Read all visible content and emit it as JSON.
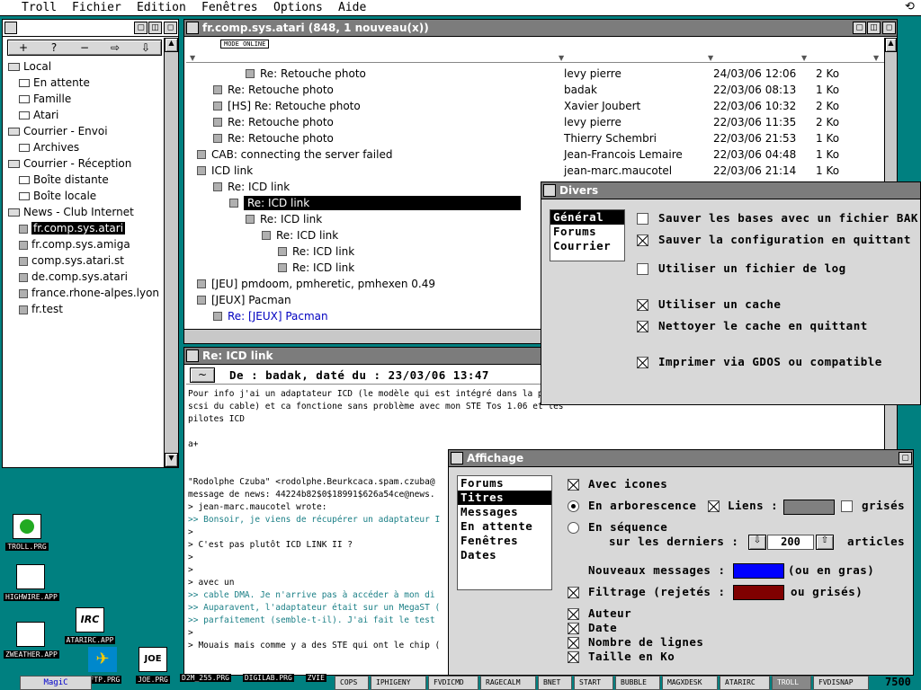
{
  "menu": {
    "items": [
      "Troll",
      "Fichier",
      "Edition",
      "Fenêtres",
      "Options",
      "Aide"
    ]
  },
  "left_toolbar": {
    "buttons": [
      "+",
      "?",
      "−",
      "⇨",
      "⇩"
    ]
  },
  "tree": {
    "items": [
      {
        "label": "Local",
        "level": 0,
        "icon": "folder-icon"
      },
      {
        "label": "En attente",
        "level": 1,
        "icon": "envelope-icon"
      },
      {
        "label": "Famille",
        "level": 1,
        "icon": "envelope-icon"
      },
      {
        "label": "Atari",
        "level": 1,
        "icon": "envelope-icon"
      },
      {
        "label": "Courrier - Envoi",
        "level": 0,
        "icon": "folder-icon"
      },
      {
        "label": "Archives",
        "level": 1,
        "icon": "envelope-icon"
      },
      {
        "label": "Courrier - Réception",
        "level": 0,
        "icon": "folder-icon"
      },
      {
        "label": "Boîte distante",
        "level": 1,
        "icon": "envelope-icon"
      },
      {
        "label": "Boîte locale",
        "level": 1,
        "icon": "envelope-icon"
      },
      {
        "label": "News - Club Internet",
        "level": 0,
        "icon": "folder-icon"
      },
      {
        "label": "fr.comp.sys.atari",
        "level": 1,
        "icon": "newsgroup-icon",
        "selected": true
      },
      {
        "label": "fr.comp.sys.amiga",
        "level": 1,
        "icon": "newsgroup-icon"
      },
      {
        "label": "comp.sys.atari.st",
        "level": 1,
        "icon": "newsgroup-icon"
      },
      {
        "label": "de.comp.sys.atari",
        "level": 1,
        "icon": "newsgroup-icon"
      },
      {
        "label": "france.rhone-alpes.lyon",
        "level": 1,
        "icon": "newsgroup-icon"
      },
      {
        "label": "fr.test",
        "level": 1,
        "icon": "newsgroup-icon"
      }
    ]
  },
  "thread_window": {
    "title": "fr.comp.sys.atari (848, 1 nouveau(x))",
    "mode_label": "MODE ONLINE",
    "rows": [
      {
        "subject": "Re: Retouche photo",
        "indent": 3,
        "from": "levy pierre",
        "date": "24/03/06 12:06",
        "size": "2 Ko"
      },
      {
        "subject": "Re: Retouche photo",
        "indent": 1,
        "from": "badak",
        "date": "22/03/06 08:13",
        "size": "1 Ko"
      },
      {
        "subject": "[HS] Re: Retouche photo",
        "indent": 1,
        "from": "Xavier Joubert",
        "date": "22/03/06 10:32",
        "size": "2 Ko"
      },
      {
        "subject": "Re: Retouche photo",
        "indent": 1,
        "from": "levy pierre",
        "date": "22/03/06 11:35",
        "size": "2 Ko"
      },
      {
        "subject": "Re: Retouche photo",
        "indent": 1,
        "from": "Thierry Schembri",
        "date": "22/03/06 21:53",
        "size": "1 Ko"
      },
      {
        "subject": "CAB: connecting the server failed",
        "indent": 0,
        "from": "Jean-Francois Lemaire",
        "date": "22/03/06 04:48",
        "size": "1 Ko"
      },
      {
        "subject": "ICD link",
        "indent": 0,
        "from": "jean-marc.maucotel",
        "date": "22/03/06 21:14",
        "size": "1 Ko"
      },
      {
        "subject": "Re: ICD link",
        "indent": 1,
        "from": "",
        "date": "",
        "size": ""
      },
      {
        "subject": "Re: ICD link",
        "indent": 2,
        "from": "",
        "date": "",
        "size": "",
        "selected": true
      },
      {
        "subject": "Re: ICD link",
        "indent": 3,
        "from": "",
        "date": "",
        "size": ""
      },
      {
        "subject": "Re: ICD link",
        "indent": 4,
        "from": "",
        "date": "",
        "size": ""
      },
      {
        "subject": "Re: ICD link",
        "indent": 5,
        "from": "",
        "date": "",
        "size": ""
      },
      {
        "subject": "Re: ICD link",
        "indent": 5,
        "from": "",
        "date": "",
        "size": ""
      },
      {
        "subject": "[JEU] pmdoom, pmheretic, pmhexen 0.49",
        "indent": 0,
        "from": "",
        "date": "",
        "size": ""
      },
      {
        "subject": "[JEUX] Pacman",
        "indent": 0,
        "from": "",
        "date": "",
        "size": ""
      },
      {
        "subject": "Re: [JEUX] Pacman",
        "indent": 1,
        "from": "",
        "date": "",
        "size": "",
        "new": true
      }
    ]
  },
  "message_window": {
    "title": "Re: ICD link",
    "header": "De : badak, daté du : 23/03/06 13:47",
    "lines": [
      {
        "text": "Pour info j'ai un adaptateur ICD (le modèle qui est intégré dans la prise",
        "quote": false
      },
      {
        "text": "scsi du cable) et ca fonctione sans problème avec mon STE Tos 1.06 et les",
        "quote": false
      },
      {
        "text": "pilotes ICD",
        "quote": false
      },
      {
        "text": "",
        "quote": false
      },
      {
        "text": "a+",
        "quote": false
      },
      {
        "text": "",
        "quote": false
      },
      {
        "text": "",
        "quote": false
      },
      {
        "text": "\"Rodolphe Czuba\" <rodolphe.Beurkcaca.spam.czuba@",
        "quote": false
      },
      {
        "text": "message de news: 44224b82$0$18991$626a54ce@news.",
        "quote": false
      },
      {
        "text": "> jean-marc.maucotel wrote:",
        "quote": false
      },
      {
        "text": ">> Bonsoir, je viens de récupérer un adaptateur I",
        "quote": true
      },
      {
        "text": ">",
        "quote": false
      },
      {
        "text": "> C'est pas plutôt ICD LINK II  ?",
        "quote": false
      },
      {
        "text": ">",
        "quote": false
      },
      {
        "text": ">",
        "quote": false
      },
      {
        "text": "> avec un",
        "quote": false
      },
      {
        "text": ">> cable DMA. Je n'arrive pas à accéder à mon di",
        "quote": true
      },
      {
        "text": ">> Auparavent, l'adaptateur était sur un MegaST (",
        "quote": true
      },
      {
        "text": ">> parfaitement (semble-t-il). J'ai fait le test",
        "quote": true
      },
      {
        "text": ">",
        "quote": false
      },
      {
        "text": "> Mouais mais comme y a des STE qui ont le chip (",
        "quote": false
      }
    ]
  },
  "divers_dialog": {
    "title": "Divers",
    "categories": [
      "Général",
      "Forums",
      "Courrier"
    ],
    "options": [
      {
        "label": "Sauver les bases avec un fichier BAK",
        "checked": false
      },
      {
        "label": "Sauver la configuration en quittant",
        "checked": true
      },
      {
        "label": "Utiliser un fichier de log",
        "checked": false
      },
      {
        "label": "Utiliser un cache",
        "checked": true
      },
      {
        "label": "Nettoyer le cache en quittant",
        "checked": true
      },
      {
        "label": "Imprimer via GDOS ou compatible",
        "checked": true
      }
    ]
  },
  "affichage_dialog": {
    "title": "Affichage",
    "categories": [
      "Forums",
      "Titres",
      "Messages",
      "En attente",
      "Fenêtres",
      "Dates"
    ],
    "avec_icones": "Avec icones",
    "en_arborescence": "En arborescence",
    "liens": "Liens :",
    "grises": "grisés",
    "en_sequence": "En séquence",
    "sur_les_derniers": "sur les derniers :",
    "count": "200",
    "articles": "articles",
    "nouveaux_messages": "Nouveaux messages :",
    "ou_en_gras": "(ou en gras)",
    "filtrage": "Filtrage (rejetés :",
    "ou_grises": "ou grisés)",
    "columns": [
      "Auteur",
      "Date",
      "Nombre de lignes",
      "Taille en Ko"
    ],
    "colors": {
      "liens": "#808080",
      "nouveaux": "#0000ff",
      "filtrage": "#7f0000"
    }
  },
  "desktop_icons": [
    "TROLL.PRG",
    "HIGHWIRE.APP",
    "ZWEATHER.APP",
    "ATARIRC.APP",
    "AFTP.PRG",
    "JOE.PRG",
    "D2M_255.PRG",
    "DIGILAB.PRG",
    "ZVIE"
  ],
  "taskbar": {
    "start": "MagiC",
    "apps": [
      "COPS",
      "IPHIGENY",
      "FVDICMD",
      "RAGECALM",
      "BNET",
      "START",
      "BUBBLE",
      "MAGXDESK",
      "ATARIRC",
      "TROLL",
      "FVDISNAP"
    ],
    "active": "TROLL",
    "clock": "7500"
  }
}
